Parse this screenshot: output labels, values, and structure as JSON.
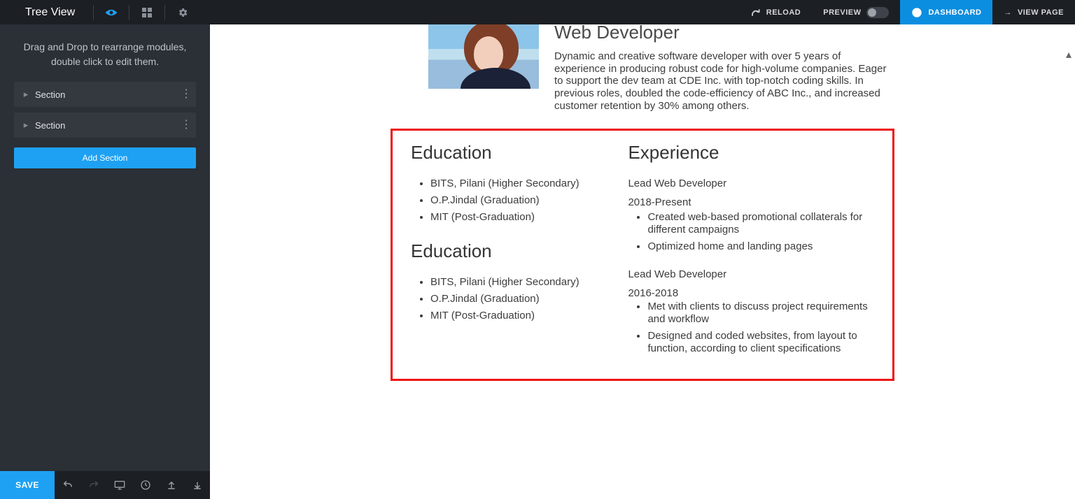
{
  "topbar": {
    "title": "Tree View",
    "reload": "RELOAD",
    "preview": "PREVIEW",
    "dashboard": "DASHBOARD",
    "viewpage": "VIEW PAGE"
  },
  "sidebar": {
    "hint_line1": "Drag and Drop to rearrange modules,",
    "hint_line2": "double click to edit them.",
    "nodes": [
      {
        "label": "Section"
      },
      {
        "label": "Section"
      }
    ],
    "add": "Add Section"
  },
  "bottom": {
    "save": "SAVE"
  },
  "resume": {
    "role": "Web Developer",
    "summary": "Dynamic and creative software developer with over 5 years of experience in producing robust code for high-volume companies. Eager to support the dev team at CDE Inc. with top-notch coding skills. In previous roles, doubled the code-efficiency of ABC Inc., and increased customer retention by 30% among others.",
    "edu_title": "Education",
    "edu": [
      "BITS, Pilani (Higher Secondary)",
      "O.P.Jindal (Graduation)",
      "MIT (Post-Graduation)"
    ],
    "edu2_title": "Education",
    "edu2": [
      "BITS, Pilani (Higher Secondary)",
      "O.P.Jindal (Graduation)",
      "MIT (Post-Graduation)"
    ],
    "exp_title": "Experience",
    "job1_title": "Lead Web Developer",
    "job1_period": "2018-Present",
    "job1_items": [
      "Created web-based promotional collaterals for different campaigns",
      "Optimized home and landing pages"
    ],
    "job2_title": "Lead Web Developer",
    "job2_period": "2016-2018",
    "job2_items": [
      "Met with clients to discuss project requirements and workflow",
      "Designed and coded websites, from layout to function, according to client specifications"
    ]
  }
}
